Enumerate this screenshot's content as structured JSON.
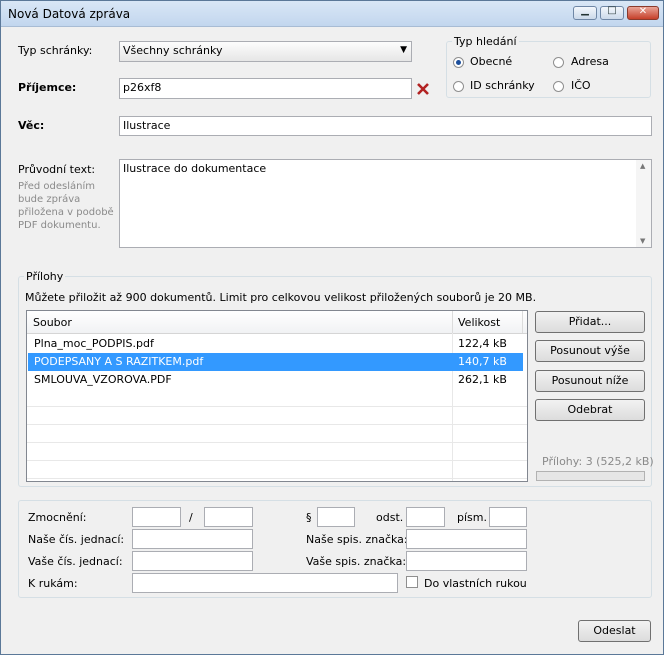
{
  "window": {
    "title": "Nová Datová zpráva",
    "btn_min": "▁",
    "btn_max": "□",
    "btn_close": "✕"
  },
  "form": {
    "typ_schranky_label": "Typ schránky:",
    "typ_schranky_value": "Všechny schránky",
    "prijemce_label": "Příjemce:",
    "prijemce_value": "p26xf8",
    "vec_label": "Věc:",
    "vec_value": "Ilustrace",
    "pruvodni_label": "Průvodní text:",
    "pruvodni_hint": [
      "Před odesláním",
      "bude zpráva",
      "přiložena v podobě",
      "PDF dokumentu."
    ],
    "pruvodni_value": "Ilustrace do dokumentace"
  },
  "search_type": {
    "title": "Typ hledání",
    "options": [
      {
        "label": "Obecné",
        "selected": true
      },
      {
        "label": "Adresa",
        "selected": false
      },
      {
        "label": "ID schránky",
        "selected": false
      },
      {
        "label": "IČO",
        "selected": false
      }
    ]
  },
  "attachments": {
    "title": "Přílohy",
    "info": "Můžete přiložit až 900 dokumentů. Limit pro celkovou velikost přiložených souborů je 20 MB.",
    "columns": [
      "Soubor",
      "Velikost"
    ],
    "rows": [
      {
        "name": "Plna_moc_PODPIS.pdf",
        "size": "122,4 kB",
        "selected": false
      },
      {
        "name": "PODEPSANY A S RAZITKEM.pdf",
        "size": "140,7 kB",
        "selected": true
      },
      {
        "name": "SMLOUVA_VZOROVA.PDF",
        "size": "262,1 kB",
        "selected": false
      }
    ],
    "buttons": {
      "add": "Přidat...",
      "up": "Posunout výše",
      "down": "Posunout níže",
      "remove": "Odebrat"
    },
    "summary": "Přílohy: 3 (525,2 kB)"
  },
  "bottom": {
    "zmocneni": "Zmocnění:",
    "slash": "/",
    "para": "§",
    "odst": "odst.",
    "pism": "písm.",
    "nase_cj": "Naše čís. jednací:",
    "nase_sz": "Naše spis. značka:",
    "vase_cj": "Vaše čís. jednací:",
    "vase_sz": "Vaše spis. značka:",
    "k_rukam": "K rukám:",
    "do_rukou": "Do vlastních rukou"
  },
  "actions": {
    "send": "Odeslat"
  },
  "colors": {
    "selection": "#3399ff",
    "delete_icon": "#b22222"
  }
}
